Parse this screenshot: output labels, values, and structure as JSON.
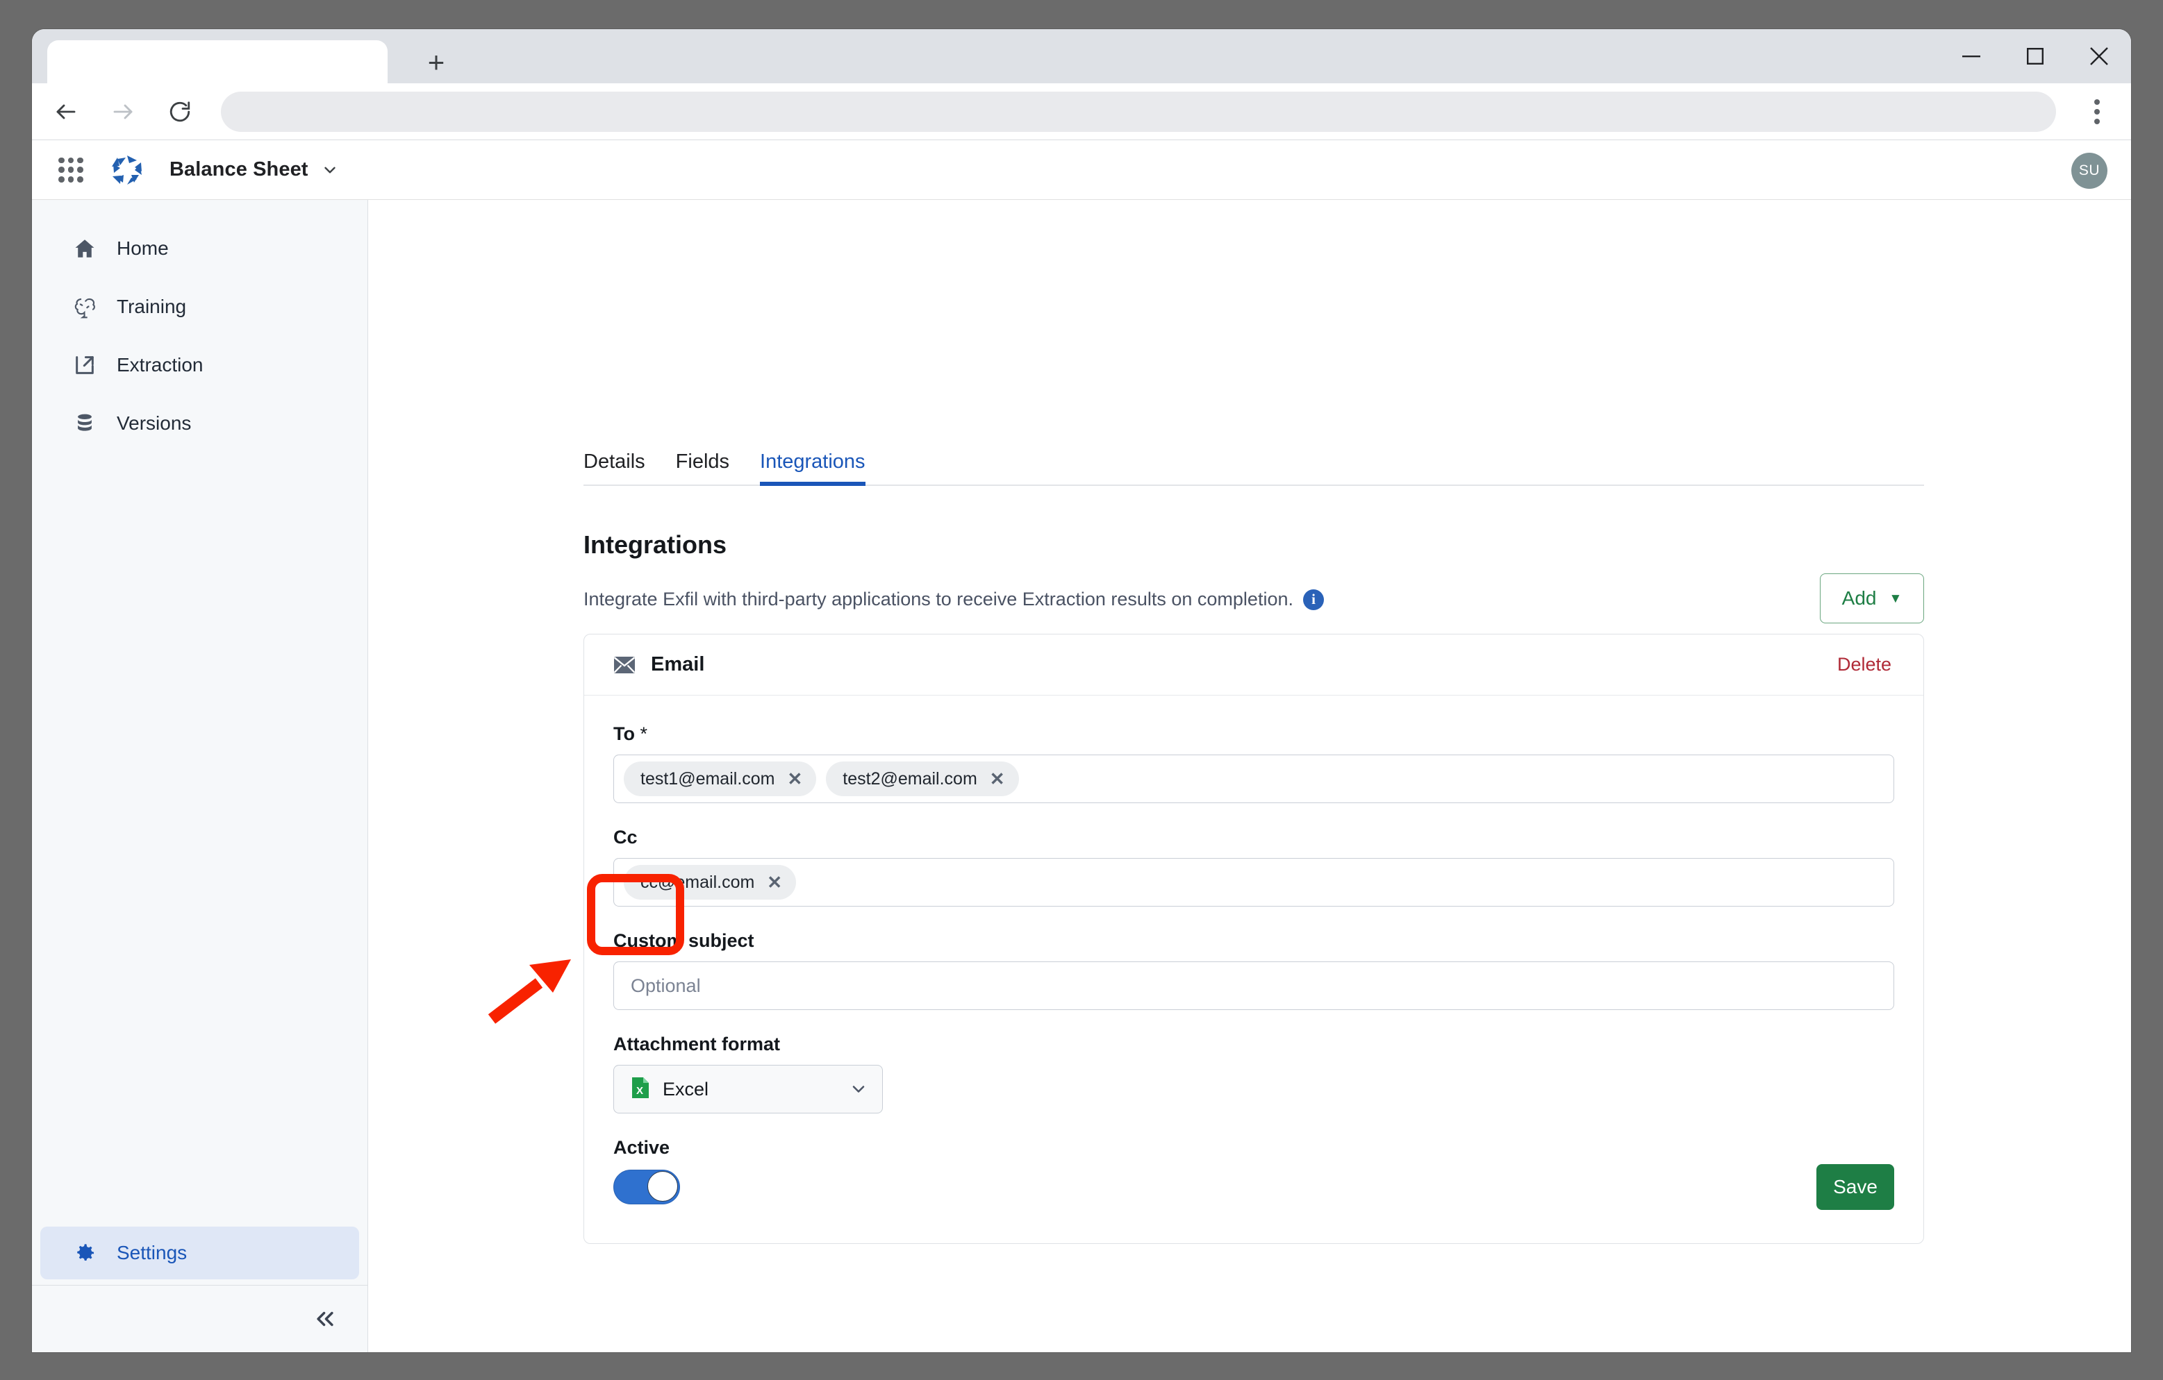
{
  "browser": {
    "tab_title": "",
    "new_tab_label": "+",
    "address_value": "",
    "back_icon": "back-arrow-icon",
    "forward_icon": "forward-arrow-icon",
    "reload_icon": "reload-icon",
    "menu_icon": "kebab-menu-icon",
    "minimize_label": "—",
    "maximize_label": "□",
    "close_label": "✕"
  },
  "app_header": {
    "apps_grid_icon": "apps-grid-icon",
    "logo_icon": "brand-pinwheel-logo",
    "title": "Balance Sheet",
    "title_caret": "chevron-down-icon",
    "avatar_initials": "SU"
  },
  "sidebar": {
    "items": [
      {
        "label": "Home",
        "icon": "home-icon"
      },
      {
        "label": "Training",
        "icon": "brain-icon"
      },
      {
        "label": "Extraction",
        "icon": "external-link-icon"
      },
      {
        "label": "Versions",
        "icon": "database-icon"
      }
    ],
    "settings": {
      "label": "Settings",
      "icon": "gear-icon"
    },
    "collapse_icon": "double-chevron-left-icon"
  },
  "tabs": [
    {
      "label": "Details",
      "selected": false
    },
    {
      "label": "Fields",
      "selected": false
    },
    {
      "label": "Integrations",
      "selected": true
    }
  ],
  "page": {
    "title": "Integrations",
    "description": "Integrate Exfil with third-party applications to receive Extraction results on completion.",
    "info_icon": "info-icon",
    "add_label": "Add",
    "add_caret": "▼"
  },
  "integration_card": {
    "icon": "envelope-icon",
    "title": "Email",
    "delete_label": "Delete",
    "to": {
      "label": "To",
      "required_mark": "*",
      "chips": [
        "test1@email.com",
        "test2@email.com"
      ],
      "chip_remove_icon": "✕"
    },
    "cc": {
      "label": "Cc",
      "chips": [
        "cc@email.com"
      ],
      "chip_remove_icon": "✕"
    },
    "custom_subject": {
      "label": "Custom subject",
      "value": "",
      "placeholder": "Optional"
    },
    "attachment_format": {
      "label": "Attachment format",
      "value": "Excel",
      "icon": "excel-file-icon",
      "caret": "chevron-down-icon"
    },
    "active": {
      "label": "Active",
      "state": "on"
    },
    "save_label": "Save"
  },
  "annotations": {
    "highlight_color": "#f82200",
    "highlight_target": "active-toggle",
    "arrow_icon": "red-pointer-arrow"
  },
  "colors": {
    "accent_blue": "#1a56b8",
    "green": "#1e7e45",
    "danger_red": "#b02a37",
    "toggle_on": "#2f71cf"
  }
}
